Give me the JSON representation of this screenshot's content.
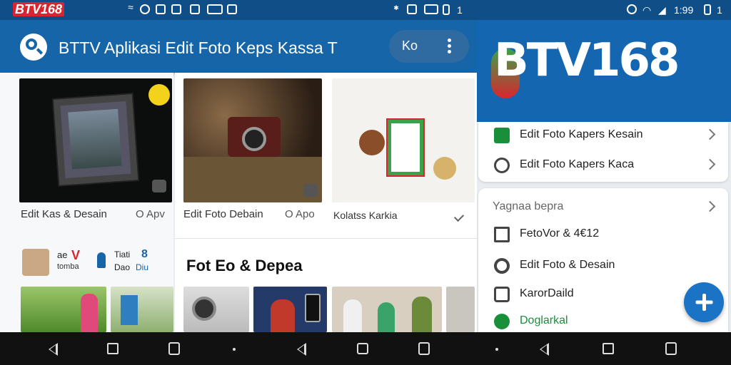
{
  "status_bar": {
    "logo": "BTV168",
    "left_time": "1",
    "right_time": "1:99",
    "right_num": "1"
  },
  "app_bar": {
    "title": "BTTV Aplikasi Edit Foto Keps Kassa T",
    "pill_text": "Ko"
  },
  "left_panel": {
    "caption_main": "Edit Kas & Desain",
    "caption_extra": "O Apv",
    "mini_row": {
      "text1": "ae",
      "text2": "V",
      "text3": "tomba",
      "text4": "Tiati",
      "text5": "8",
      "text6": "Dao",
      "text7": "Diu"
    }
  },
  "mid_panel": {
    "card1_caption": "Edit Foto Debain",
    "card1_extra": "O Apo",
    "card2_caption": "Kolatss Karkia",
    "section_title": "Fot Eo & Depea"
  },
  "drawer": {
    "brand": "BTV168",
    "items_top": [
      {
        "label": "Edit Foto Kapers Kesain",
        "icon": "check-square-icon"
      },
      {
        "label": "Edit Foto Kapers Kaca",
        "icon": "circle-icon"
      }
    ],
    "section_header": "Yagnaa bepra",
    "items_bottom": [
      {
        "label": "FetoVor & 4€12",
        "icon": "grid-icon"
      },
      {
        "label": "Edit Foto & Desain",
        "icon": "search-icon"
      },
      {
        "label": "KarorDaild",
        "icon": "window-icon"
      },
      {
        "label": "Doglarkal",
        "icon": "check-circle-icon"
      }
    ]
  },
  "colors": {
    "primary": "#1565a8",
    "status": "#0f4e87",
    "fab": "#1a73c4",
    "accent_red": "#d9262e",
    "accent_green": "#1a8f3a"
  }
}
